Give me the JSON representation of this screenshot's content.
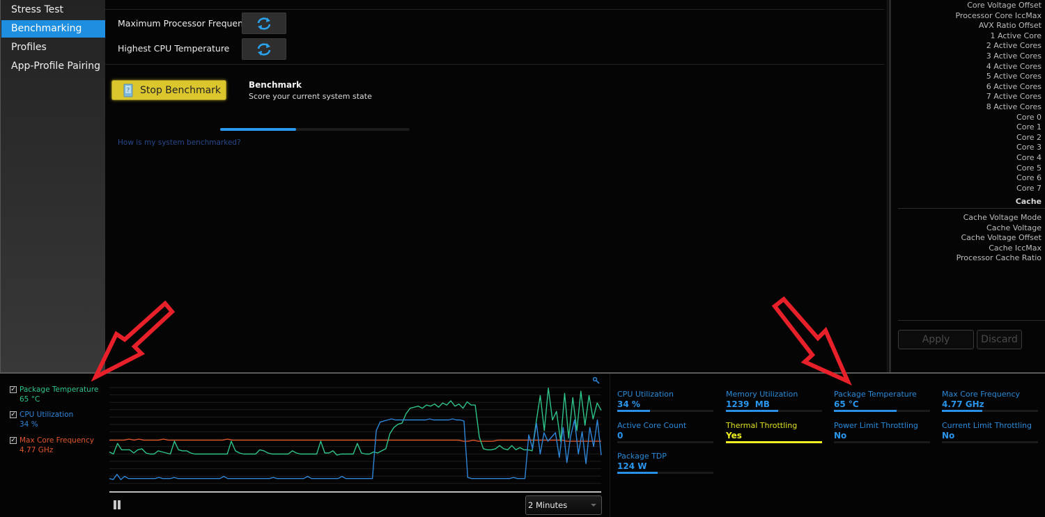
{
  "sidebar": {
    "items": [
      {
        "label": "Stress Test",
        "active": false
      },
      {
        "label": "Benchmarking",
        "active": true
      },
      {
        "label": "Profiles",
        "active": false
      },
      {
        "label": "App-Profile Pairing",
        "active": false
      }
    ]
  },
  "main": {
    "rows": [
      {
        "label": "Maximum Processor Frequency",
        "button_icon": "refresh-icon"
      },
      {
        "label": "Highest CPU Temperature",
        "button_icon": "refresh-icon"
      }
    ],
    "stop_button": {
      "label": "Stop Benchmark",
      "icon": "benchmark-icon"
    },
    "benchmark": {
      "title": "Benchmark",
      "subtitle": "Score your current system state",
      "progress": 0.4
    },
    "help_link": "How is my system benchmarked?"
  },
  "right_panel": {
    "core_props": [
      "Core Voltage Offset",
      "Processor Core IccMax",
      "AVX Ratio Offset",
      "1 Active Core",
      "2 Active Cores",
      "3 Active Cores",
      "4 Active Cores",
      "5 Active Cores",
      "6 Active Cores",
      "7 Active Cores",
      "8 Active Cores",
      "Core 0",
      "Core 1",
      "Core 2",
      "Core 3",
      "Core 4",
      "Core 5",
      "Core 6",
      "Core 7"
    ],
    "cache_header": "Cache",
    "cache_props": [
      "Cache Voltage Mode",
      "Cache Voltage",
      "Cache Voltage Offset",
      "Cache IccMax",
      "Processor Cache Ratio"
    ],
    "apply_label": "Apply",
    "discard_label": "Discard"
  },
  "monitor": {
    "legend": [
      {
        "name": "Package Temperature",
        "value": "65 °C",
        "checked": true,
        "color": "#2fc48a"
      },
      {
        "name": "CPU Utilization",
        "value": "34 %",
        "checked": true,
        "color": "#2f86d8"
      },
      {
        "name": "Max Core Frequency",
        "value": "4.77 GHz",
        "checked": true,
        "color": "#e0552a"
      }
    ],
    "time_range": "2 Minutes",
    "stats": [
      {
        "label": "CPU Utilization",
        "value": "34 %",
        "fill": 0.34,
        "warn": false
      },
      {
        "label": "Memory Utilization",
        "value": "1239  MB",
        "fill": 0.54,
        "warn": false
      },
      {
        "label": "Package Temperature",
        "value": "65 °C",
        "fill": 0.65,
        "warn": false
      },
      {
        "label": "Max Core Frequency",
        "value": "4.77 GHz",
        "fill": 0.42,
        "warn": false
      },
      {
        "label": "Active Core Count",
        "value": "0",
        "fill": 0,
        "warn": false
      },
      {
        "label": "Thermal Throttling",
        "value": "Yes",
        "fill": 1.0,
        "warn": true
      },
      {
        "label": "Power Limit Throttling",
        "value": "No",
        "fill": 0,
        "warn": false
      },
      {
        "label": "Current Limit Throttling",
        "value": "No",
        "fill": 0,
        "warn": false
      },
      {
        "label": "Package TDP",
        "value": "124 W",
        "fill": 0.42,
        "warn": false
      }
    ]
  },
  "chart_data": {
    "type": "line",
    "title": "",
    "xlabel": "",
    "ylabel": "",
    "ylim": [
      0,
      100
    ],
    "grid": true,
    "legend": "left",
    "series": [
      {
        "name": "Max Core Frequency",
        "color": "#e0552a",
        "values": [
          46,
          46,
          46,
          46,
          47,
          46,
          47,
          46,
          46,
          46,
          46,
          47,
          46,
          46,
          46,
          46,
          46,
          46,
          46,
          46,
          46,
          46,
          46,
          46,
          47,
          46,
          46,
          46,
          46,
          46,
          46,
          46,
          46,
          46,
          46,
          46,
          46,
          46,
          46,
          46,
          46,
          46,
          46,
          46,
          46,
          46,
          46,
          46,
          46,
          46,
          46,
          46,
          46,
          46,
          46,
          46,
          46,
          46,
          46,
          46,
          46,
          46,
          46,
          46,
          46,
          46,
          46,
          46,
          46,
          46,
          46,
          46,
          45,
          45,
          46,
          45,
          45,
          45,
          45,
          46,
          46,
          46,
          46,
          46,
          46,
          46,
          46,
          46,
          46,
          46,
          46,
          46,
          46,
          45,
          45,
          45,
          45,
          45,
          45,
          45,
          45
        ]
      },
      {
        "name": "Package Temperature",
        "color": "#2fc48a",
        "values": [
          35,
          33,
          43,
          37,
          37,
          37,
          34,
          37,
          38,
          34,
          33,
          33,
          36,
          35,
          34,
          33,
          45,
          37,
          36,
          36,
          34,
          33,
          33,
          33,
          33,
          33,
          33,
          33,
          33,
          33,
          45,
          36,
          34,
          33,
          33,
          33,
          33,
          37,
          36,
          34,
          33,
          33,
          33,
          33,
          33,
          36,
          34,
          33,
          33,
          33,
          33,
          33,
          45,
          34,
          34,
          36,
          32,
          33,
          33,
          33,
          33,
          43,
          34,
          33,
          33,
          35,
          34,
          36,
          38,
          52,
          58,
          61,
          62,
          71,
          76,
          77,
          78,
          76,
          79,
          78,
          80,
          77,
          81,
          79,
          83,
          78,
          80,
          76,
          82,
          79,
          79,
          49,
          38,
          37,
          37,
          38,
          41,
          38,
          37,
          41,
          37,
          39,
          37,
          37,
          36,
          63,
          88,
          55,
          95,
          65,
          73,
          45,
          90,
          48,
          86,
          55,
          92,
          60,
          88,
          66,
          81,
          74
        ]
      },
      {
        "name": "CPU Utilization",
        "color": "#2f86d8",
        "values": [
          10,
          9,
          14,
          9,
          12,
          10,
          10,
          10,
          10,
          10,
          10,
          10,
          10,
          11,
          10,
          10,
          10,
          11,
          10,
          10,
          10,
          10,
          10,
          10,
          10,
          10,
          10,
          10,
          10,
          10,
          12,
          10,
          10,
          10,
          10,
          10,
          10,
          10,
          10,
          10,
          10,
          10,
          10,
          11,
          10,
          10,
          10,
          10,
          10,
          10,
          10,
          10,
          12,
          10,
          10,
          10,
          10,
          10,
          10,
          10,
          10,
          12,
          10,
          10,
          10,
          10,
          10,
          10,
          10,
          10,
          55,
          63,
          64,
          65,
          66,
          65,
          65,
          65,
          65,
          65,
          65,
          65,
          65,
          65,
          66,
          65,
          65,
          65,
          65,
          65,
          66,
          65,
          65,
          64,
          11,
          10,
          10,
          10,
          10,
          10,
          10,
          10,
          10,
          10,
          10,
          10,
          11,
          10,
          10,
          10,
          51,
          38,
          62,
          33,
          53,
          45,
          49,
          53,
          30,
          58,
          25,
          50,
          65,
          33,
          54,
          24,
          58,
          40,
          65,
          32
        ]
      }
    ]
  }
}
